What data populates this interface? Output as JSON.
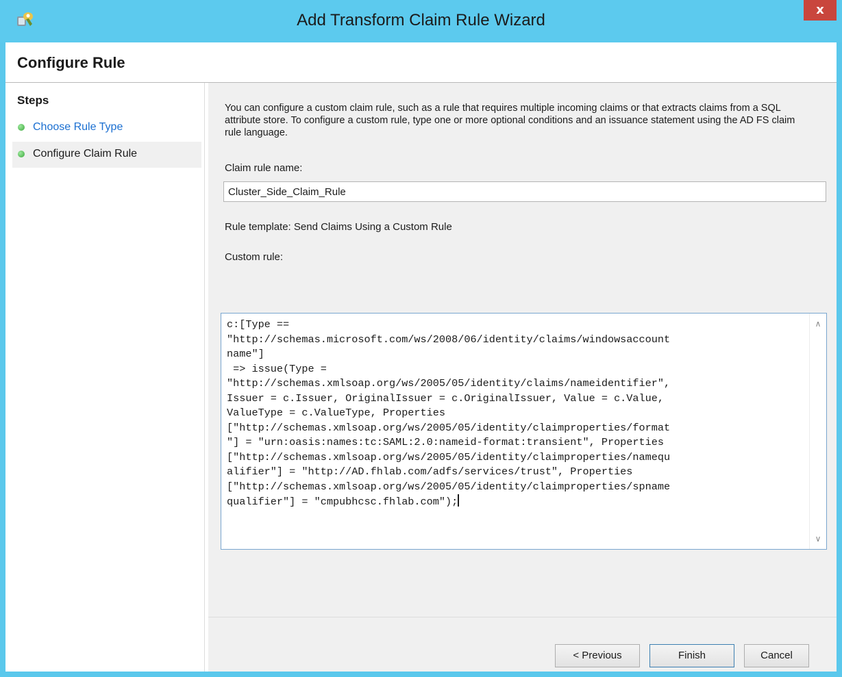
{
  "window": {
    "title": "Add Transform Claim Rule Wizard",
    "close_label": "x"
  },
  "header": {
    "page_title": "Configure Rule"
  },
  "steps": {
    "heading": "Steps",
    "items": [
      {
        "label": "Choose Rule Type",
        "state": "link"
      },
      {
        "label": "Configure Claim Rule",
        "state": "current"
      }
    ]
  },
  "content": {
    "description": "You can configure a custom claim rule, such as a rule that requires multiple incoming claims or that extracts claims from a SQL attribute store. To configure a custom rule, type one or more optional conditions and an issuance statement using the AD FS claim rule language.",
    "claim_rule_name_label": "Claim rule name:",
    "claim_rule_name_value": "Cluster_Side_Claim_Rule",
    "rule_template_text": "Rule template: Send Claims Using a Custom Rule",
    "custom_rule_label": "Custom rule:",
    "custom_rule_text": "c:[Type ==\n\"http://schemas.microsoft.com/ws/2008/06/identity/claims/windowsaccount\nname\"]\n => issue(Type =\n\"http://schemas.xmlsoap.org/ws/2005/05/identity/claims/nameidentifier\",\nIssuer = c.Issuer, OriginalIssuer = c.OriginalIssuer, Value = c.Value,\nValueType = c.ValueType, Properties\n[\"http://schemas.xmlsoap.org/ws/2005/05/identity/claimproperties/format\n\"] = \"urn:oasis:names:tc:SAML:2.0:nameid-format:transient\", Properties\n[\"http://schemas.xmlsoap.org/ws/2005/05/identity/claimproperties/namequ\nalifier\"] = \"http://AD.fhlab.com/adfs/services/trust\", Properties\n[\"http://schemas.xmlsoap.org/ws/2005/05/identity/claimproperties/spname\nqualifier\"] = \"cmpubhcsc.fhlab.com\");"
  },
  "footer": {
    "previous_label": "< Previous",
    "finish_label": "Finish",
    "cancel_label": "Cancel"
  },
  "colors": {
    "titlebar": "#5ccaee",
    "close_button": "#c9463d",
    "link": "#1a6fd1",
    "step_dot": "#3aa83a",
    "content_background": "#f0f0f0"
  },
  "icons": {
    "app": "adfs-wizard-icon",
    "close": "close-icon",
    "step_status": "green-dot-icon",
    "scroll_up": "chevron-up-icon",
    "scroll_down": "chevron-down-icon"
  }
}
